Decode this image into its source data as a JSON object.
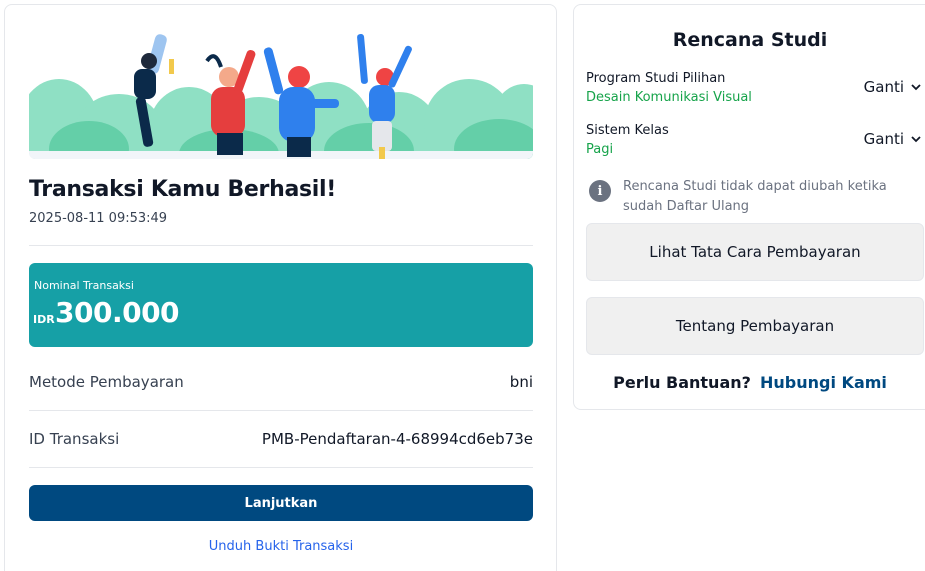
{
  "transaction": {
    "title": "Transaksi Kamu Berhasil!",
    "datetime": "2025-08-11 09:53:49",
    "amount_label": "Nominal Transaksi",
    "currency": "IDR",
    "amount": "300.000",
    "method_label": "Metode Pembayaran",
    "method_value": "bni",
    "id_label": "ID Transaksi",
    "id_value": "PMB-Pendaftaran-4-68994cd6eb73e",
    "continue_button": "Lanjutkan",
    "download_link": "Unduh Bukti Transaksi"
  },
  "study_plan": {
    "title": "Rencana Studi",
    "program_label": "Program Studi Pilihan",
    "program_value": "Desain Komunikasi Visual",
    "class_label": "Sistem Kelas",
    "class_value": "Pagi",
    "change_label": "Ganti",
    "notice": "Rencana Studi tidak dapat diubah ketika sudah Daftar Ulang",
    "payment_guide_button": "Lihat Tata Cara Pembayaran",
    "about_payment_button": "Tentang Pembayaran",
    "help_question": "Perlu Bantuan?",
    "help_link": "Hubungi Kami"
  },
  "colors": {
    "amount_bg": "#16a0a6",
    "primary": "#004980",
    "success_text": "#16a34a",
    "link": "#2563eb"
  },
  "icons": {
    "info": "info-circle-icon",
    "chevron": "chevron-down-icon"
  }
}
